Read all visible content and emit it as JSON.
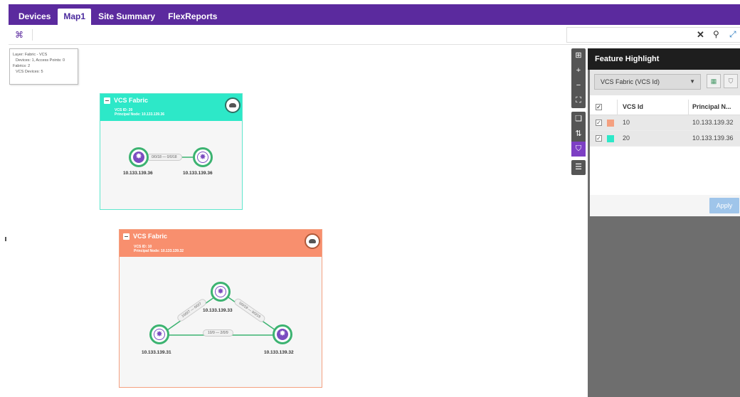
{
  "tabs": [
    {
      "label": "Devices"
    },
    {
      "label": "Map1"
    },
    {
      "label": "Site Summary"
    },
    {
      "label": "FlexReports"
    }
  ],
  "toolbar": {
    "search_value": "",
    "icons": {
      "map": "map-icon",
      "clear": "close-icon",
      "search": "search-icon",
      "expand": "expand-icon"
    }
  },
  "legend": {
    "line1": "Layer: Fabric - VCS",
    "line2": "Devices: 1, Access Points: 0",
    "line3": "Fabrics: 2",
    "line4": "VCS Devices: 5"
  },
  "fabrics": [
    {
      "title": "VCS Fabric",
      "sub1": "VCS ID: 20",
      "sub2": "Principal Node: 10.133.139.36",
      "color": "#2de8c8",
      "nodes": [
        "10.133.139.36",
        "10.133.139.36"
      ],
      "link_label": "0/0/18 — 0/0/18"
    },
    {
      "title": "VCS Fabric",
      "sub1": "VCS ID: 10",
      "sub2": "Principal Node: 10.133.139.32",
      "color": "#f88f6e",
      "nodes": [
        "10.133.139.33",
        "10.133.139.31",
        "10.133.139.32"
      ],
      "links": [
        "10/0/7 — 0/0/7",
        "0/0/19 — 0/0/19",
        "10/9 — 2/0/9"
      ]
    }
  ],
  "panel": {
    "title": "Feature Highlight",
    "select_value": "VCS Fabric (VCS Id)",
    "columns": [
      "VCS Id",
      "Principal N..."
    ],
    "rows": [
      {
        "id": "10",
        "principal": "10.133.139.32",
        "color": "#f4a080"
      },
      {
        "id": "20",
        "principal": "10.133.139.36",
        "color": "#2de8c8"
      }
    ],
    "apply_label": "Apply"
  }
}
